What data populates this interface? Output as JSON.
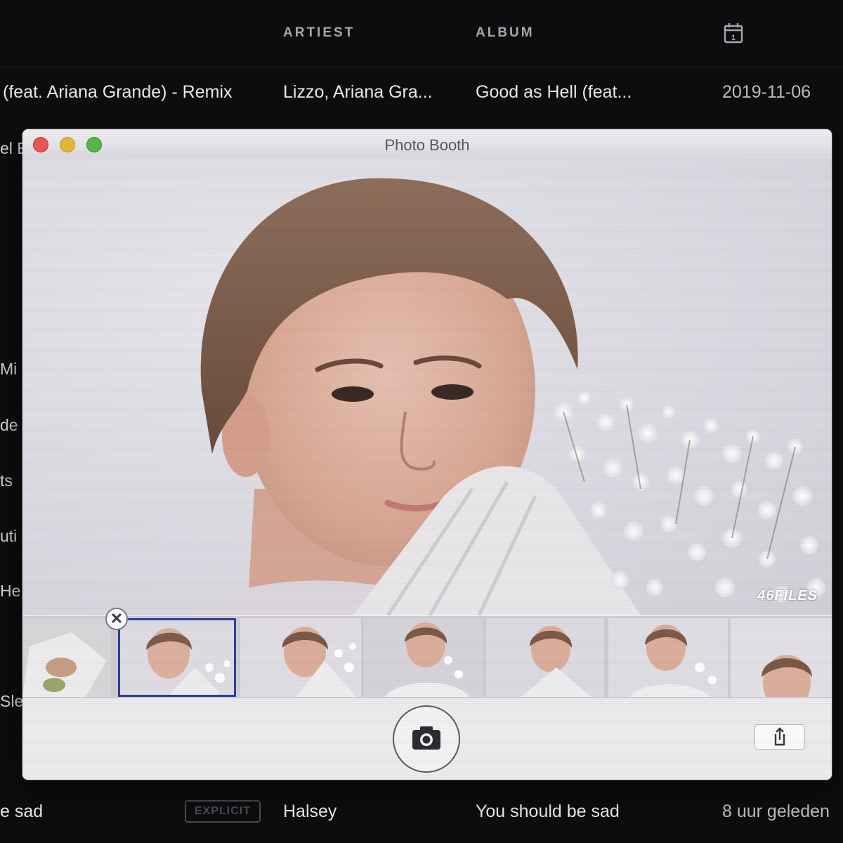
{
  "music": {
    "columns": {
      "artist": "ARTIEST",
      "album": "ALBUM"
    },
    "top_row": {
      "title": "(feat. Ariana Grande) - Remix",
      "artist": "Lizzo, Ariana Gra...",
      "album": "Good as Hell (feat...",
      "date": "2019-11-06"
    },
    "side_fragments": [
      "el E",
      "Mi",
      "de",
      "ts",
      "uti",
      "He",
      "Sle"
    ],
    "bottom_row": {
      "title": "e sad",
      "badge": "EXPLICIT",
      "artist": "Halsey",
      "album": "You should be sad",
      "date": "8 uur geleden"
    }
  },
  "photo_booth": {
    "title": "Photo Booth",
    "watermark": "46FILES",
    "delete_glyph": "✕",
    "thumbnails": [
      {
        "selected": false
      },
      {
        "selected": true
      },
      {
        "selected": false
      },
      {
        "selected": false
      },
      {
        "selected": false
      },
      {
        "selected": false
      },
      {
        "selected": false
      }
    ]
  },
  "icons": {
    "calendar": "calendar-icon",
    "camera": "camera-icon",
    "share": "share-icon"
  },
  "colors": {
    "background": "#0d0d0f",
    "selection": "#2c3e9e",
    "close": "#e25955",
    "minimize": "#e5b63c",
    "zoom": "#57b747"
  }
}
